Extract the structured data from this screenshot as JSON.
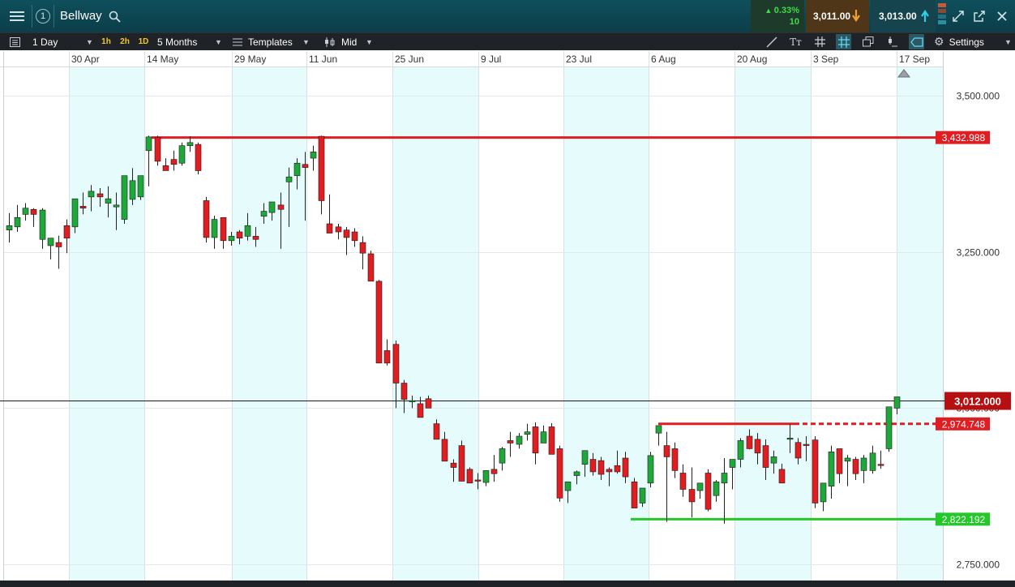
{
  "window": {
    "title": "Bellway",
    "alert_count": "1",
    "change_pct": "0.33%",
    "change_pts": "10",
    "sell_price": "3,011.00",
    "buy_price": "3,013.00"
  },
  "toolbar": {
    "timeframe": "1 Day",
    "quick_intervals": [
      "1h",
      "2h",
      "1D"
    ],
    "range": "5 Months",
    "templates_label": "Templates",
    "price_type": "Mid",
    "settings_label": "Settings"
  },
  "colors": {
    "up": "#1fa83a",
    "down": "#e01e22",
    "shade": "#e6fbfc",
    "resistance": "#e01e22",
    "support": "#24c82a",
    "current": "#1a1a1a"
  },
  "chart_data": {
    "type": "candlestick",
    "title": "",
    "x_tick_labels": [
      "30 Apr",
      "14 May",
      "29 May",
      "11 Jun",
      "25 Jun",
      "9 Jul",
      "23 Jul",
      "6 Aug",
      "20 Aug",
      "3 Sep",
      "17 Sep"
    ],
    "y_tick_labels": [
      "3,500.000",
      "3,250.000",
      "3,000.000",
      "2,750.000"
    ],
    "ylim": [
      2740,
      3548
    ],
    "candles": [
      [
        3285,
        3312,
        3265,
        3292
      ],
      [
        3290,
        3325,
        3282,
        3305
      ],
      [
        3310,
        3328,
        3300,
        3320
      ],
      [
        3318,
        3320,
        3290,
        3310
      ],
      [
        3270,
        3320,
        3255,
        3317
      ],
      [
        3260,
        3270,
        3238,
        3272
      ],
      [
        3265,
        3276,
        3223,
        3258
      ],
      [
        3292,
        3302,
        3248,
        3272
      ],
      [
        3290,
        3335,
        3280,
        3335
      ],
      [
        3323,
        3345,
        3310,
        3320
      ],
      [
        3338,
        3357,
        3315,
        3347
      ],
      [
        3343,
        3352,
        3322,
        3338
      ],
      [
        3328,
        3355,
        3305,
        3335
      ],
      [
        3322,
        3345,
        3285,
        3325
      ],
      [
        3302,
        3370,
        3295,
        3372
      ],
      [
        3334,
        3384,
        3325,
        3364
      ],
      [
        3338,
        3370,
        3333,
        3372
      ],
      [
        3412,
        3436,
        3355,
        3434
      ],
      [
        3433,
        3436,
        3388,
        3395
      ],
      [
        3388,
        3400,
        3385,
        3380
      ],
      [
        3398,
        3412,
        3380,
        3390
      ],
      [
        3392,
        3425,
        3388,
        3420
      ],
      [
        3420,
        3435,
        3410,
        3425
      ],
      [
        3422,
        3425,
        3374,
        3380
      ],
      [
        3332,
        3338,
        3265,
        3273
      ],
      [
        3273,
        3308,
        3255,
        3302
      ],
      [
        3305,
        3302,
        3255,
        3268
      ],
      [
        3268,
        3282,
        3260,
        3275
      ],
      [
        3282,
        3285,
        3262,
        3272
      ],
      [
        3275,
        3312,
        3268,
        3292
      ],
      [
        3275,
        3290,
        3258,
        3270
      ],
      [
        3307,
        3328,
        3295,
        3315
      ],
      [
        3313,
        3325,
        3300,
        3330
      ],
      [
        3325,
        3345,
        3255,
        3318
      ],
      [
        3362,
        3385,
        3290,
        3370
      ],
      [
        3372,
        3400,
        3350,
        3392
      ],
      [
        3390,
        3410,
        3300,
        3385
      ],
      [
        3400,
        3420,
        3380,
        3410
      ],
      [
        3435,
        3436,
        3310,
        3332
      ],
      [
        3295,
        3342,
        3280,
        3280
      ],
      [
        3290,
        3295,
        3270,
        3282
      ],
      [
        3285,
        3290,
        3245,
        3273
      ],
      [
        3282,
        3288,
        3258,
        3268
      ],
      [
        3265,
        3275,
        3222,
        3248
      ],
      [
        3247,
        3252,
        3210,
        3203
      ],
      [
        3203,
        3205,
        3080,
        3072
      ],
      [
        3092,
        3110,
        3068,
        3072
      ],
      [
        3102,
        3108,
        3000,
        3040
      ],
      [
        3040,
        3045,
        2992,
        3014
      ],
      [
        3010,
        3020,
        3000,
        3012
      ],
      [
        3007,
        3018,
        2985,
        2985
      ],
      [
        3015,
        3020,
        3004,
        3000
      ],
      [
        2975,
        2982,
        2950,
        2950
      ],
      [
        2950,
        2962,
        2918,
        2915
      ],
      [
        2912,
        2918,
        2882,
        2905
      ],
      [
        2940,
        2948,
        2885,
        2883
      ],
      [
        2902,
        2905,
        2880,
        2880
      ],
      [
        2885,
        2896,
        2870,
        2884
      ],
      [
        2881,
        2895,
        2875,
        2900
      ],
      [
        2902,
        2925,
        2882,
        2895
      ],
      [
        2912,
        2938,
        2900,
        2935
      ],
      [
        2948,
        2962,
        2922,
        2944
      ],
      [
        2942,
        2960,
        2935,
        2955
      ],
      [
        2958,
        2975,
        2948,
        2962
      ],
      [
        2970,
        2977,
        2910,
        2928
      ],
      [
        2944,
        2972,
        2948,
        2962
      ],
      [
        2970,
        2976,
        2948,
        2926
      ],
      [
        2935,
        2940,
        2850,
        2856
      ],
      [
        2868,
        2880,
        2848,
        2882
      ],
      [
        2892,
        2900,
        2878,
        2898
      ],
      [
        2910,
        2930,
        2890,
        2932
      ],
      [
        2918,
        2928,
        2892,
        2898
      ],
      [
        2916,
        2922,
        2885,
        2894
      ],
      [
        2902,
        2905,
        2875,
        2898
      ],
      [
        2908,
        2932,
        2895,
        2898
      ],
      [
        2920,
        2930,
        2880,
        2890
      ],
      [
        2882,
        2888,
        2852,
        2840
      ],
      [
        2848,
        2870,
        2842,
        2872
      ],
      [
        2880,
        2930,
        2873,
        2924
      ],
      [
        2960,
        2970,
        2940,
        2972
      ],
      [
        2940,
        2962,
        2818,
        2922
      ],
      [
        2935,
        2945,
        2888,
        2900
      ],
      [
        2896,
        2910,
        2858,
        2870
      ],
      [
        2870,
        2905,
        2825,
        2850
      ],
      [
        2868,
        2880,
        2855,
        2880
      ],
      [
        2896,
        2902,
        2835,
        2838
      ],
      [
        2860,
        2885,
        2850,
        2882
      ],
      [
        2880,
        2920,
        2815,
        2896
      ],
      [
        2905,
        2912,
        2870,
        2918
      ],
      [
        2918,
        2952,
        2905,
        2948
      ],
      [
        2955,
        2966,
        2934,
        2935
      ],
      [
        2950,
        2960,
        2910,
        2928
      ],
      [
        2940,
        2950,
        2885,
        2905
      ],
      [
        2912,
        2932,
        2895,
        2922
      ],
      [
        2902,
        2911,
        2880,
        2880
      ],
      [
        2952,
        2975,
        2928,
        2952
      ],
      [
        2945,
        2952,
        2910,
        2920
      ],
      [
        2942,
        2955,
        2915,
        2940
      ],
      [
        2949,
        2955,
        2840,
        2848
      ],
      [
        2850,
        2858,
        2835,
        2880
      ],
      [
        2875,
        2940,
        2855,
        2930
      ],
      [
        2935,
        2935,
        2880,
        2895
      ],
      [
        2915,
        2925,
        2875,
        2920
      ],
      [
        2918,
        2922,
        2885,
        2895
      ],
      [
        2900,
        2925,
        2880,
        2920
      ],
      [
        2900,
        2940,
        2895,
        2928
      ],
      [
        2910,
        2932,
        2903,
        2909
      ],
      [
        2935,
        2958,
        2930,
        3002
      ],
      [
        3000,
        3015,
        2990,
        3018
      ]
    ],
    "horizontal_levels": [
      {
        "value": 3432.988,
        "label": "3,432.988",
        "style": "solid",
        "color": "red"
      },
      {
        "value": 2974.748,
        "label": "2,974.748",
        "style": "solid-then-dashed",
        "color": "red"
      },
      {
        "value": 2822.192,
        "label": "2,822.192",
        "style": "solid",
        "color": "green"
      }
    ],
    "current_price": {
      "value": 3012.0,
      "label": "3,012.000"
    }
  }
}
